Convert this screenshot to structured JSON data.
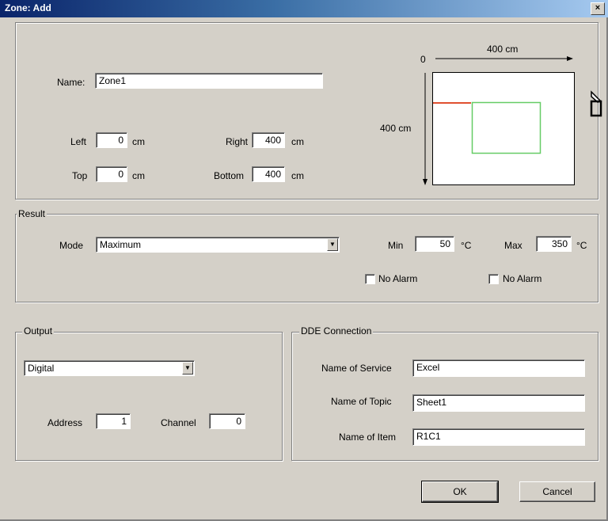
{
  "window": {
    "title": "Zone: Add",
    "close_glyph": "×"
  },
  "area": {
    "name_label": "Name:",
    "name_value": "Zone1",
    "left_label": "Left",
    "left_value": "0",
    "left_unit": "cm",
    "top_label": "Top",
    "top_value": "0",
    "top_unit": "cm",
    "right_label": "Right",
    "right_value": "400",
    "right_unit": "cm",
    "bottom_label": "Bottom",
    "bottom_value": "400",
    "bottom_unit": "cm"
  },
  "preview": {
    "origin_label": "0",
    "x_extent_label": "400 cm",
    "y_extent_label": "400 cm",
    "zone_color": "#66cc66",
    "origin_marker_color": "#e05030"
  },
  "result": {
    "group_label": "Result",
    "mode_label": "Mode",
    "mode_value": "Maximum",
    "min_label": "Min",
    "min_value": "50",
    "min_unit": "°C",
    "max_label": "Max",
    "max_value": "350",
    "max_unit": "°C",
    "min_no_alarm_label": "No Alarm",
    "max_no_alarm_label": "No Alarm"
  },
  "output": {
    "group_label": "Output",
    "type_value": "Digital",
    "address_label": "Address",
    "address_value": "1",
    "channel_label": "Channel",
    "channel_value": "0"
  },
  "dde": {
    "group_label": "DDE Connection",
    "service_label": "Name of Service",
    "service_value": "Excel",
    "topic_label": "Name of Topic",
    "topic_value": "Sheet1",
    "item_label": "Name of Item",
    "item_value": "R1C1"
  },
  "buttons": {
    "ok_label": "OK",
    "cancel_label": "Cancel"
  }
}
